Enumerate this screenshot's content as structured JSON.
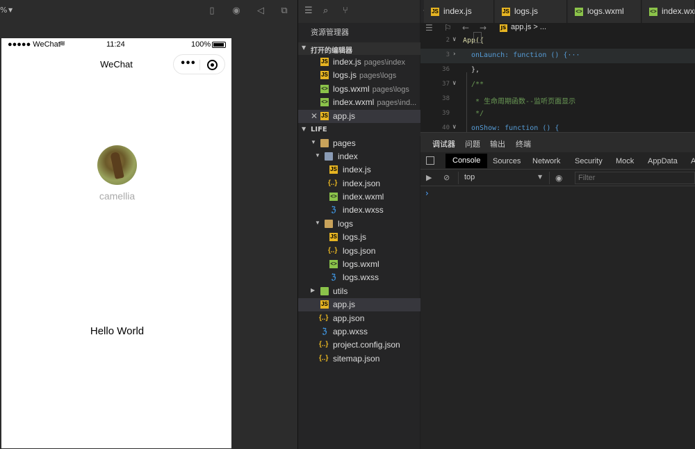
{
  "simulator": {
    "zoom_label": "%",
    "phone": {
      "carrier": "●●●●● WeChat",
      "wifi_icon": "wifi-icon",
      "time": "11:24",
      "battery": "100%",
      "nav_title": "WeChat",
      "capsule_more": "•••",
      "user_nickname": "camellia",
      "hello_text": "Hello World"
    }
  },
  "explorer": {
    "title": "资源管理器",
    "open_editors_label": "打开的编辑器",
    "open_editors": [
      {
        "name": "index.js",
        "path": "pages\\index",
        "type": "js"
      },
      {
        "name": "logs.js",
        "path": "pages\\logs",
        "type": "js"
      },
      {
        "name": "logs.wxml",
        "path": "pages\\logs",
        "type": "wxml"
      },
      {
        "name": "index.wxml",
        "path": "pages\\ind...",
        "type": "wxml"
      },
      {
        "name": "app.js",
        "path": "",
        "type": "js",
        "active": true
      }
    ],
    "project_label": "LIFE",
    "tree": {
      "pages": "pages",
      "index": "index",
      "index_js": "index.js",
      "index_json": "index.json",
      "index_wxml": "index.wxml",
      "index_wxss": "index.wxss",
      "logs": "logs",
      "logs_js": "logs.js",
      "logs_json": "logs.json",
      "logs_wxml": "logs.wxml",
      "logs_wxss": "logs.wxss",
      "utils": "utils",
      "app_js": "app.js",
      "app_json": "app.json",
      "app_wxss": "app.wxss",
      "project_config": "project.config.json",
      "sitemap": "sitemap.json"
    }
  },
  "editor": {
    "tabs": [
      "index.js",
      "logs.js",
      "logs.wxml",
      "index.wxml"
    ],
    "breadcrumb": "app.js > ...",
    "lines": [
      {
        "no": "2",
        "text": "App({"
      },
      {
        "no": "3",
        "text": "onLaunch: function () {···"
      },
      {
        "no": "36",
        "text": "},"
      },
      {
        "no": "37",
        "text": "/**"
      },
      {
        "no": "38",
        "text": " * 生命周期函数--监听页面显示"
      },
      {
        "no": "39",
        "text": " */"
      },
      {
        "no": "40",
        "text": "onShow: function () {"
      }
    ]
  },
  "devtools": {
    "top_tabs": [
      "调试器",
      "问题",
      "输出",
      "终端"
    ],
    "panel_tabs": [
      "Console",
      "Sources",
      "Network",
      "Security",
      "Mock",
      "AppData",
      "A"
    ],
    "context": "top",
    "filter_placeholder": "Filter",
    "prompt": "›"
  }
}
